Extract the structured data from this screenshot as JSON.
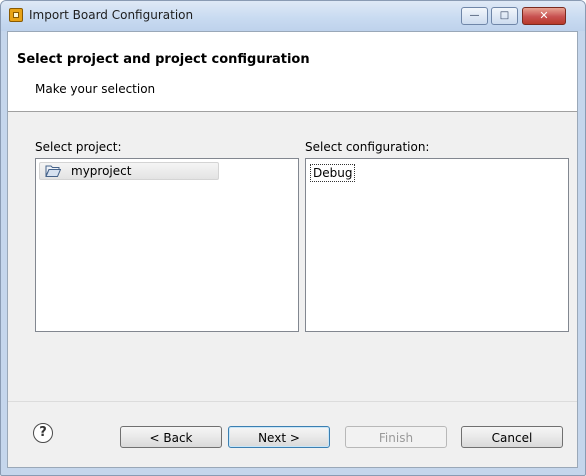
{
  "window": {
    "title": "Import Board Configuration",
    "controls": {
      "minimize": "—",
      "maximize": "□",
      "close": "✕"
    }
  },
  "header": {
    "title": "Select project and project configuration",
    "subtitle": "Make your selection"
  },
  "project_panel": {
    "label": "Select project:",
    "items": [
      {
        "name": "myproject",
        "icon": "open-folder-icon"
      }
    ]
  },
  "configuration_panel": {
    "label": "Select configuration:",
    "items": [
      {
        "name": "Debug",
        "focused": true
      }
    ]
  },
  "footer": {
    "help": "?",
    "back": "< Back",
    "next": "Next >",
    "finish": "Finish",
    "finish_enabled": false,
    "cancel": "Cancel"
  }
}
